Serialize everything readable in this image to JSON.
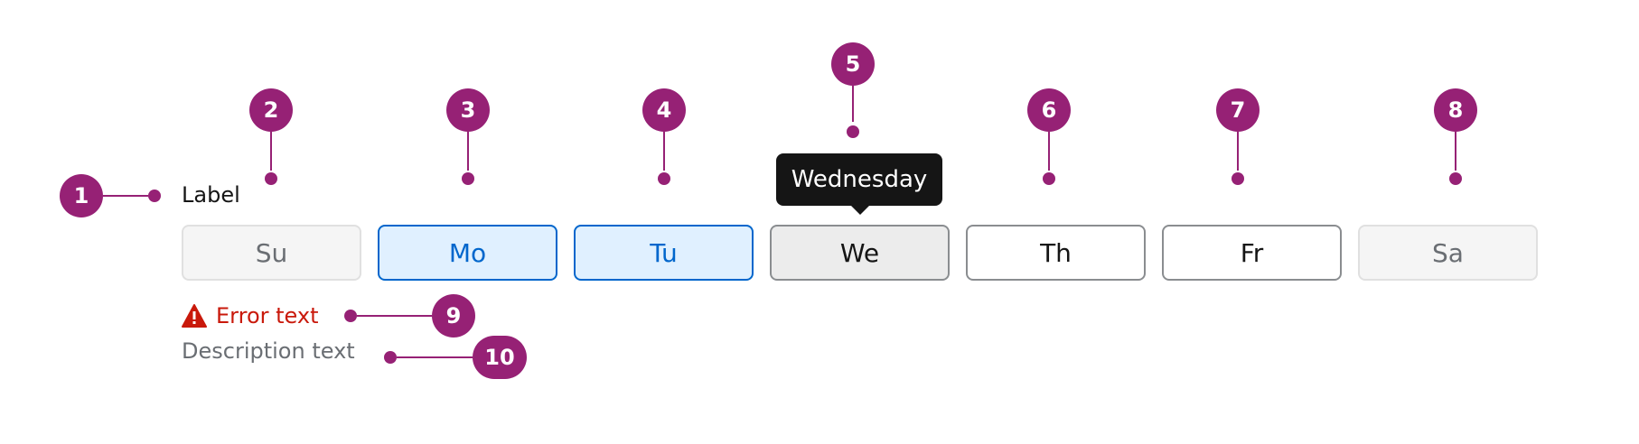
{
  "field": {
    "label": "Label",
    "error_text": "Error text",
    "description_text": "Description text",
    "error_icon": "warning-triangle-icon"
  },
  "days": [
    {
      "label": "Su",
      "state": "disabled"
    },
    {
      "label": "Mo",
      "state": "selected"
    },
    {
      "label": "Tu",
      "state": "selected"
    },
    {
      "label": "We",
      "state": "hover"
    },
    {
      "label": "Th",
      "state": "default"
    },
    {
      "label": "Fr",
      "state": "default"
    },
    {
      "label": "Sa",
      "state": "disabled"
    }
  ],
  "tooltip": {
    "text": "Wednesday"
  },
  "markers": [
    "1",
    "2",
    "3",
    "4",
    "5",
    "6",
    "7",
    "8",
    "9",
    "10"
  ],
  "colors": {
    "marker": "#962175",
    "selected_bg": "#e0f0ff",
    "selected_border": "#0066cc",
    "error": "#c9190b",
    "tooltip_bg": "#151515"
  }
}
